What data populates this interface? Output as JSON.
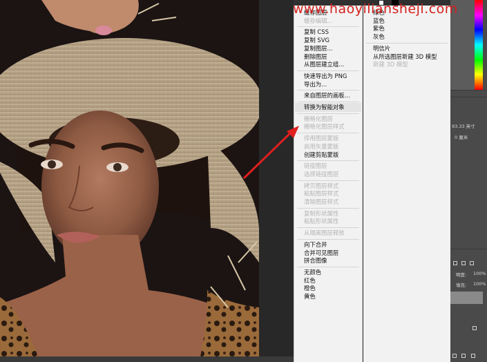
{
  "watermark": "www.haoyiliansheji.com",
  "menu_main": [
    {
      "label": "缓存图层",
      "disabled": false
    },
    {
      "label": "缓存编辑...",
      "disabled": true
    },
    {
      "sep": true
    },
    {
      "label": "复制 CSS",
      "disabled": false
    },
    {
      "label": "复制 SVG",
      "disabled": false
    },
    {
      "label": "复制图层...",
      "disabled": false
    },
    {
      "label": "删除图层",
      "disabled": false
    },
    {
      "label": "从图层建立组...",
      "disabled": false
    },
    {
      "sep": true
    },
    {
      "label": "快速导出为 PNG",
      "disabled": false
    },
    {
      "label": "导出为...",
      "disabled": false
    },
    {
      "sep": true
    },
    {
      "label": "来自图层的画板...",
      "disabled": false
    },
    {
      "sep": true
    },
    {
      "label": "转换为智能对象",
      "disabled": false,
      "highlight": true
    },
    {
      "sep": true
    },
    {
      "label": "栅格化图层",
      "disabled": true
    },
    {
      "label": "栅格化图层样式",
      "disabled": true
    },
    {
      "sep": true
    },
    {
      "label": "停用图层蒙版",
      "disabled": true
    },
    {
      "label": "启用矢量蒙版",
      "disabled": true
    },
    {
      "label": "创建剪贴蒙版",
      "disabled": false
    },
    {
      "sep": true
    },
    {
      "label": "链接图层",
      "disabled": true
    },
    {
      "label": "选择链接图层",
      "disabled": true
    },
    {
      "sep": true
    },
    {
      "label": "拷贝图层样式",
      "disabled": true
    },
    {
      "label": "粘贴图层样式",
      "disabled": true
    },
    {
      "label": "清除图层样式",
      "disabled": true
    },
    {
      "sep": true
    },
    {
      "label": "复制形状属性",
      "disabled": true
    },
    {
      "label": "粘贴形状属性",
      "disabled": true
    },
    {
      "sep": true
    },
    {
      "label": "从隔离图层释放",
      "disabled": true
    },
    {
      "sep": true
    },
    {
      "label": "向下合并",
      "disabled": false
    },
    {
      "label": "合并可见图层",
      "disabled": false
    },
    {
      "label": "拼合图像",
      "disabled": false
    },
    {
      "sep": true
    },
    {
      "label": "无颜色",
      "disabled": false
    },
    {
      "label": "红色",
      "disabled": false
    },
    {
      "label": "橙色",
      "disabled": false
    },
    {
      "label": "黄色",
      "disabled": false
    }
  ],
  "menu_sub": [
    {
      "label": "绿色",
      "disabled": false
    },
    {
      "label": "蓝色",
      "disabled": false
    },
    {
      "label": "紫色",
      "disabled": false
    },
    {
      "label": "灰色",
      "disabled": false
    },
    {
      "sep": true
    },
    {
      "label": "明信片",
      "disabled": false
    },
    {
      "label": "从所选图层新建 3D 模型",
      "disabled": false
    },
    {
      "label": "新建 3D 模型",
      "disabled": true
    }
  ],
  "panel": {
    "dim_w": "93.33 英寸",
    "dim_h": "0 厘米",
    "opacity_label": "明度:",
    "opacity_value": "100%",
    "fill_label": "填充:",
    "fill_value": "100%"
  }
}
